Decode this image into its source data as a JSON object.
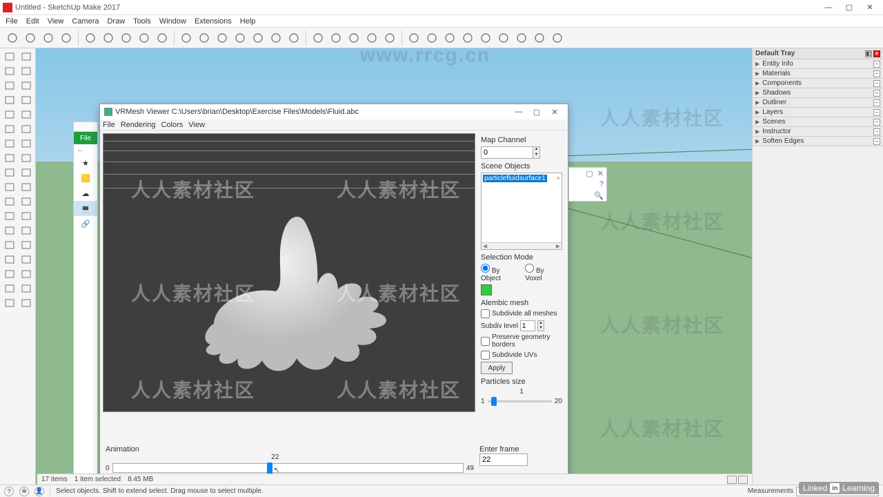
{
  "app": {
    "title": "Untitled - SketchUp Make 2017",
    "menubar": [
      "File",
      "Edit",
      "View",
      "Camera",
      "Draw",
      "Tools",
      "Window",
      "Extensions",
      "Help"
    ],
    "top_watermark": "www.rrcg.cn"
  },
  "top_toolbar_icons": [
    "new-model-icon",
    "circle-icon",
    "sync-icon",
    "cloud-icon",
    "separator",
    "layer-icon",
    "layer-front-icon",
    "layer-swap-icon",
    "layer-back-icon",
    "layer-hide-icon",
    "separator",
    "shape-rect-icon",
    "shape-circle-icon",
    "shape-tri-icon",
    "shape-hex-icon",
    "shape-star-icon",
    "shape-round-icon",
    "shape-arc-icon",
    "separator",
    "car-icon",
    "box-icon",
    "cube-icon",
    "spring-icon",
    "material-icon",
    "separator",
    "cube-select-icon",
    "cube-multi-icon",
    "note-icon",
    "cube-outline-icon",
    "cube-solid-icon",
    "sphere-icon",
    "ring-icon",
    "target-icon",
    "wand-icon"
  ],
  "left_toolbar_icons": [
    [
      "select-icon",
      "cube-small-icon"
    ],
    [
      "paint-icon",
      "eraser-icon"
    ],
    [
      "pencil-icon",
      "freehand-icon"
    ],
    [
      "rectangle-icon",
      "rotated-rect-icon"
    ],
    [
      "circle-tool-icon",
      "polygon-icon"
    ],
    [
      "arc-icon",
      "pie-icon"
    ],
    [
      "bezier-icon",
      "spline-icon"
    ],
    [
      "move-icon",
      "rotate-icon"
    ],
    [
      "scale-icon",
      "offset-icon"
    ],
    [
      "pushpull-icon",
      "followme-icon"
    ],
    [
      "tape-icon",
      "protractor-icon"
    ],
    [
      "text-icon",
      "axis-icon"
    ],
    [
      "dimension-icon",
      "section-icon"
    ],
    [
      "zoom-icon",
      "zoom-extents-icon"
    ],
    [
      "orbit-icon",
      "pan-icon"
    ],
    [
      "walk-icon",
      "look-icon"
    ],
    [
      "position-icon",
      "prev-icon"
    ],
    [
      "people-icon",
      "component-icon"
    ]
  ],
  "tray": {
    "header": "Default Tray",
    "items": [
      "Entity Info",
      "Materials",
      "Components",
      "Shadows",
      "Outliner",
      "Layers",
      "Scenes",
      "Instructor",
      "Soften Edges"
    ]
  },
  "dialog": {
    "title": "VRMesh Viewer  C:\\Users\\brian\\Desktop\\Exercise Files\\Models\\Fluid.abc",
    "menubar": [
      "File",
      "Rendering",
      "Colors",
      "View"
    ],
    "map_channel": {
      "label": "Map Channel",
      "value": "0"
    },
    "scene_objects": {
      "label": "Scene Objects",
      "selected": "particlefluidsurface1"
    },
    "selection_mode": {
      "label": "Selection Mode",
      "by_object": "By Object",
      "by_voxel": "By Voxel",
      "selected": "object"
    },
    "alembic": {
      "label": "Alembic mesh",
      "subdivide_all": "Subdivide all meshes",
      "subdiv_level_label": "Subdiv level",
      "subdiv_level": "1",
      "preserve": "Preserve geometry borders",
      "subdivide_uvs": "Subdivide UVs",
      "apply": "Apply"
    },
    "particles": {
      "label": "Particles size",
      "tick": "1",
      "min": "1",
      "max": "20",
      "value": 2
    },
    "animation": {
      "label": "Animation",
      "min": "0",
      "max": "49",
      "current": "22"
    },
    "enter_frame": {
      "label": "Enter frame",
      "value": "22"
    }
  },
  "item_status": {
    "count": "17 items",
    "selected": "1 item selected",
    "size": "8.45 MB"
  },
  "statusbar": {
    "hint": "Select objects. Shift to extend select. Drag mouse to select multiple.",
    "measure_label": "Measurements"
  },
  "side_watermark": "人人素材社区",
  "brand": {
    "linked": "Linked",
    "in": "in",
    "learning": "Learning"
  }
}
